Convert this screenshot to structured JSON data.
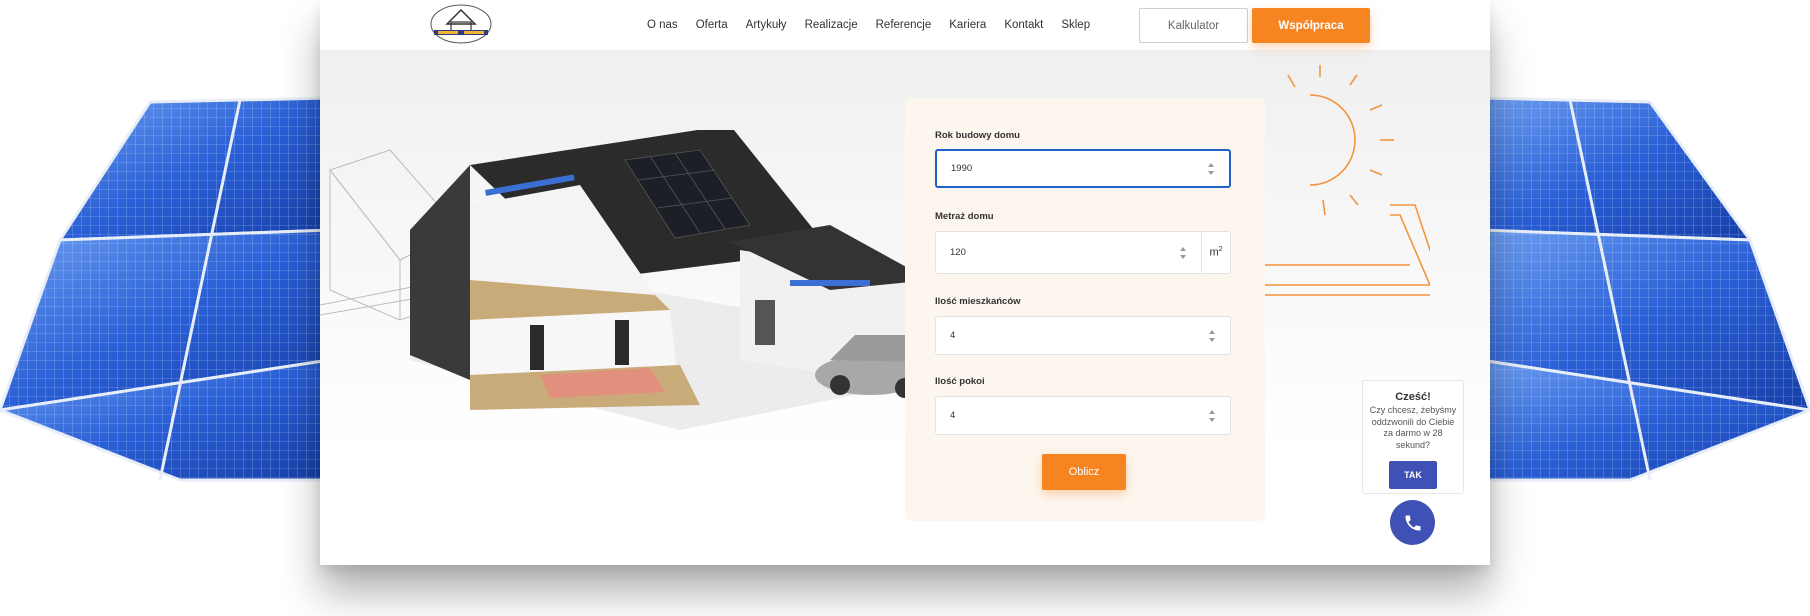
{
  "header": {
    "logo_icon": "house-logo-icon",
    "nav": [
      "O nas",
      "Oferta",
      "Artykuły",
      "Realizacje",
      "Referencje",
      "Kariera",
      "Kontakt",
      "Sklep"
    ],
    "calc_label": "Kalkulator",
    "coop_label": "Współpraca"
  },
  "form": {
    "fields": [
      {
        "label": "Rok budowy domu",
        "value": "1990"
      },
      {
        "label": "Metraż domu",
        "value": "120",
        "unit": "m",
        "unit_sup": "2"
      },
      {
        "label": "Ilość mieszkańców",
        "value": "4"
      },
      {
        "label": "Ilość pokoi",
        "value": "4"
      }
    ],
    "submit_label": "Oblicz"
  },
  "callback": {
    "title": "Cześć!",
    "message": "Czy chcesz, żebyśmy oddzwonili do Ciebie za darmo w 28 sekund?",
    "yes_label": "TAK",
    "phone_icon": "phone-icon"
  },
  "colors": {
    "accent": "#f68420",
    "focus": "#1e61c8",
    "callback": "#3f51b5",
    "form_bg": "#fcf6ef",
    "solar_blue": "#1f4fd1"
  }
}
